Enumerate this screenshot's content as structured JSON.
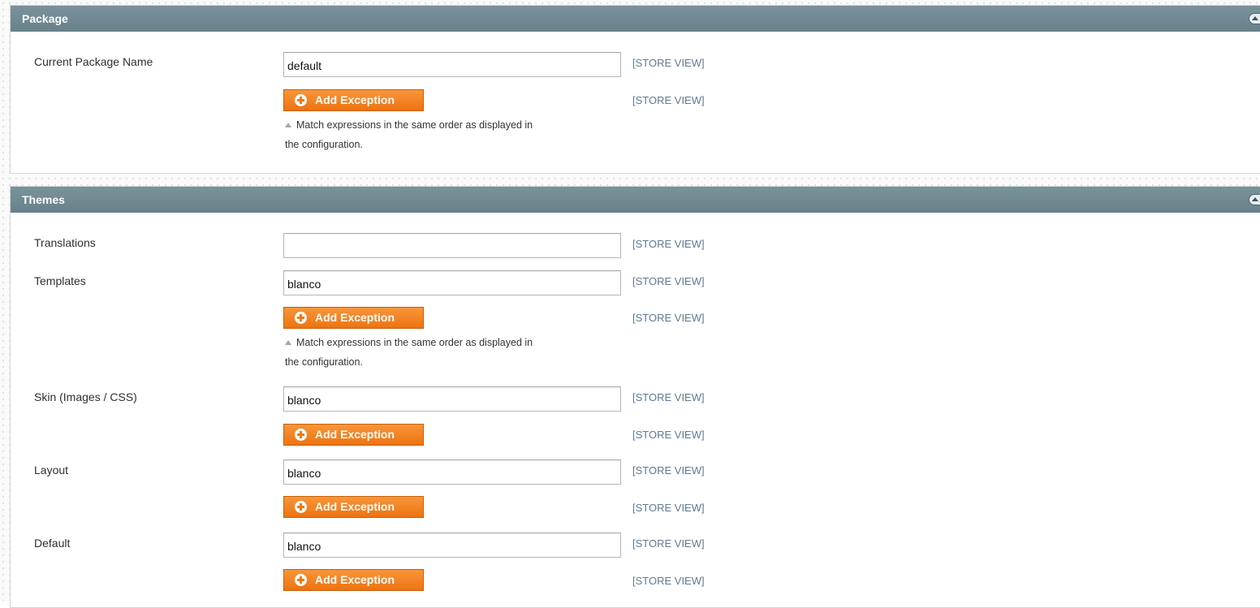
{
  "package": {
    "title": "Package",
    "current_package_label": "Current Package Name",
    "current_package_value": "default",
    "scope": "[STORE VIEW]",
    "add_exception_label": "Add Exception",
    "exception_scope": "[STORE VIEW]",
    "note_line1": "Match expressions in the same order as displayed in",
    "note_line2": "the configuration."
  },
  "themes": {
    "title": "Themes",
    "translations": {
      "label": "Translations",
      "value": "",
      "scope": "[STORE VIEW]"
    },
    "templates": {
      "label": "Templates",
      "value": "blanco",
      "scope": "[STORE VIEW]",
      "add_exception_label": "Add Exception",
      "exception_scope": "[STORE VIEW]",
      "note_line1": "Match expressions in the same order as displayed in",
      "note_line2": "the configuration."
    },
    "skin": {
      "label": "Skin (Images / CSS)",
      "value": "blanco",
      "scope": "[STORE VIEW]",
      "add_exception_label": "Add Exception",
      "exception_scope": "[STORE VIEW]"
    },
    "layout": {
      "label": "Layout",
      "value": "blanco",
      "scope": "[STORE VIEW]",
      "add_exception_label": "Add Exception",
      "exception_scope": "[STORE VIEW]"
    },
    "default": {
      "label": "Default",
      "value": "blanco",
      "scope": "[STORE VIEW]",
      "add_exception_label": "Add Exception",
      "exception_scope": "[STORE VIEW]"
    }
  },
  "colors": {
    "section_header": "#6f8992",
    "button": "#f18420",
    "scope_text": "#5f7a93"
  },
  "icons": {
    "collapse": "chevron-up-icon",
    "add": "plus-circle-icon",
    "note": "triangle-up-icon"
  }
}
